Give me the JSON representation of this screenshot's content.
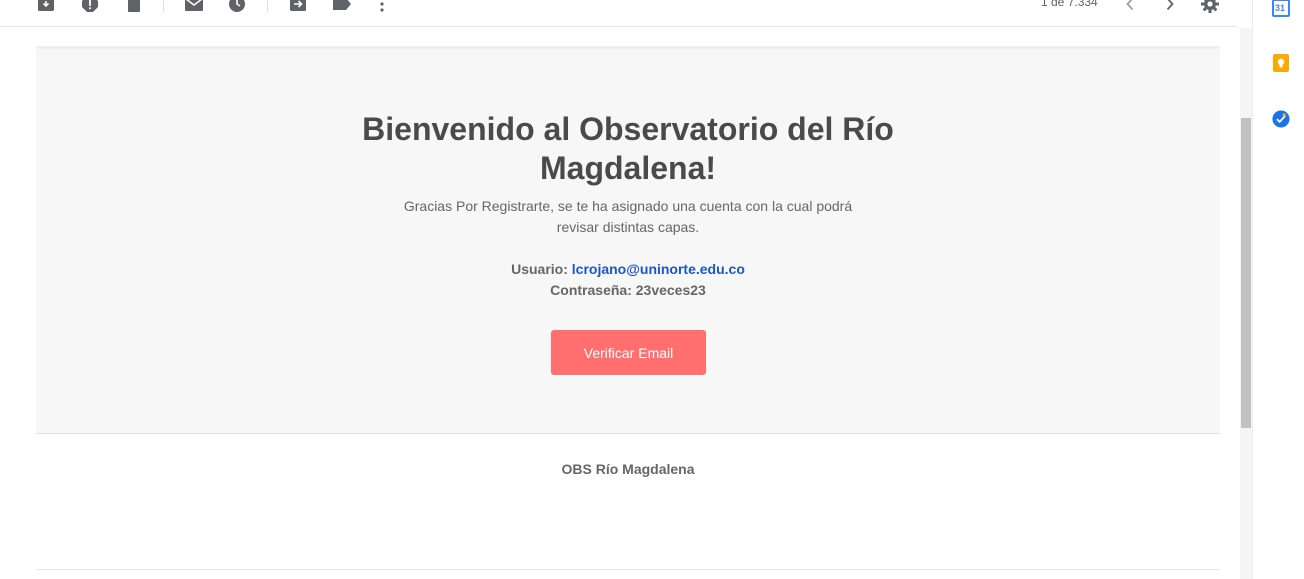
{
  "toolbar": {
    "icons": [
      "archive-icon",
      "report-spam-icon",
      "delete-icon",
      "mark-unread-icon",
      "snooze-icon",
      "move-to-icon",
      "label-icon",
      "more-options-icon"
    ],
    "count": "1 de 7.334"
  },
  "side_panel": {
    "calendar_badge": "31"
  },
  "email": {
    "headline_line1": "Bienvenido al Observatorio del Río",
    "headline_line2": "Magdalena!",
    "intro_line1": "Gracias Por Registrarte, se te ha asignado una cuenta con la cual podrá",
    "intro_line2": "revisar distintas capas.",
    "user_label": "Usuario:",
    "user_value": "lcrojano@uninorte.edu.co",
    "password_label": "Contraseña:",
    "password_value": "23veces23",
    "button_label": "Verificar Email",
    "button_color": "#ff6f6f",
    "link_color": "#1a56c4",
    "footer_name": "OBS Río Magdalena"
  }
}
